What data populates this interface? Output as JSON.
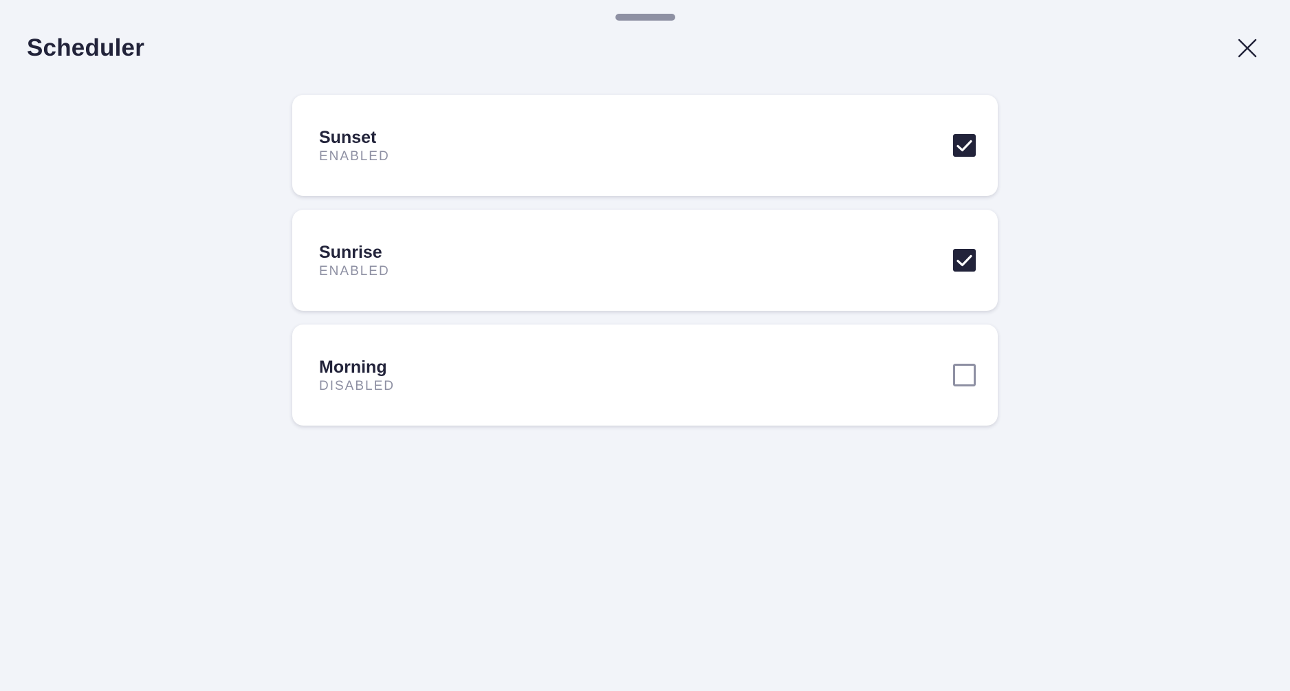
{
  "header": {
    "title": "Scheduler",
    "close_icon": "close-icon"
  },
  "colors": {
    "background": "#f2f4f9",
    "card": "#ffffff",
    "text_primary": "#22233a",
    "text_secondary": "#8e90a3",
    "checkbox_checked": "#22233a"
  },
  "schedules": [
    {
      "name": "Sunset",
      "status": "ENABLED",
      "checked": true
    },
    {
      "name": "Sunrise",
      "status": "ENABLED",
      "checked": true
    },
    {
      "name": "Morning",
      "status": "DISABLED",
      "checked": false
    }
  ]
}
